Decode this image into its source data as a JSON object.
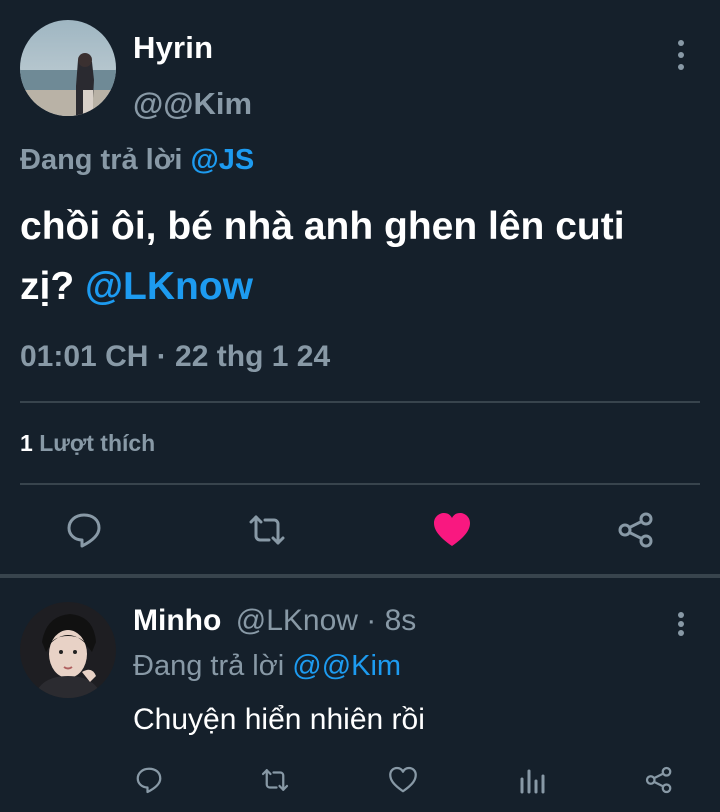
{
  "tweet": {
    "display_name": "Hyrin",
    "handle": "@@Kim",
    "reply_prefix": "Đang trả lời",
    "reply_to": "@JS",
    "text_line1": "chồi ôi, bé nhà anh ghen lên cuti",
    "text_line2_prefix": "zị?",
    "text_mention": "@LKnow",
    "timestamp": "01:01 CH · 22 thg 1 24",
    "likes_count": "1",
    "likes_label": "Lượt thích",
    "liked": true,
    "like_color": "#f91880"
  },
  "reply": {
    "display_name": "Minho",
    "handle_time": "@LKnow · 8s",
    "reply_prefix": "Đang trả lời",
    "reply_to": "@@Kim",
    "text": "Chuyện hiển nhiên rồi"
  },
  "icons": {
    "reply": "comment-icon",
    "retweet": "retweet-icon",
    "like": "heart-icon",
    "share": "share-icon",
    "analytics": "analytics-icon",
    "more": "more-vertical-icon"
  }
}
